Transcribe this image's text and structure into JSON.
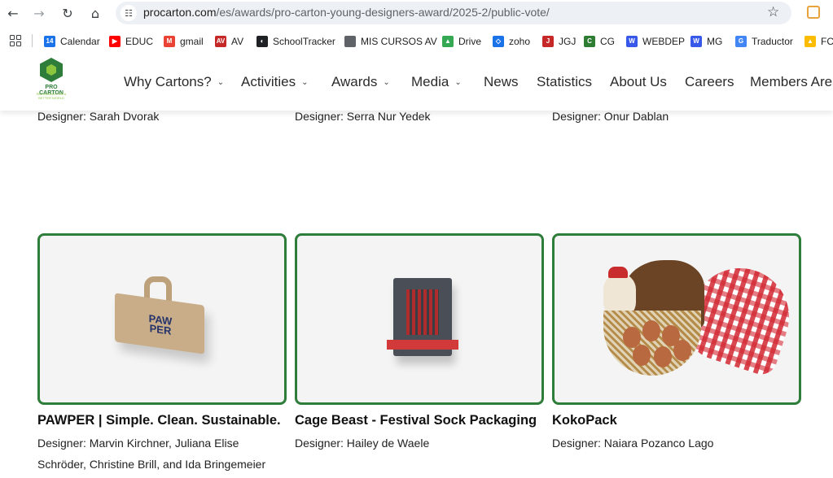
{
  "browser": {
    "url_host": "procarton.com",
    "url_path": "/es/awards/pro-carton-young-designers-award/2025-2/public-vote/",
    "bookmarks": [
      {
        "label": "Calendar",
        "icon": "calendar-icon",
        "color": "#1a73e8",
        "badge": "14"
      },
      {
        "label": "EDUC",
        "icon": "youtube-icon",
        "color": "#ff0000",
        "badge": "▶"
      },
      {
        "label": "gmail",
        "icon": "gmail-icon",
        "color": "#ea4335",
        "badge": "M"
      },
      {
        "label": "AV",
        "icon": "av-icon",
        "color": "#c62828",
        "badge": "AV"
      },
      {
        "label": "SchoolTracker",
        "icon": "schooltracker-icon",
        "color": "#202124",
        "badge": "◐"
      },
      {
        "label": "MIS CURSOS AV",
        "icon": "folder-icon",
        "color": "#5f6368",
        "badge": ""
      },
      {
        "label": "Drive",
        "icon": "drive-icon",
        "color": "#34a853",
        "badge": "▲"
      },
      {
        "label": "zoho",
        "icon": "zoho-icon",
        "color": "#1a73e8",
        "badge": "◇"
      },
      {
        "label": "JGJ",
        "icon": "jgj-icon",
        "color": "#c62828",
        "badge": "J"
      },
      {
        "label": "CG",
        "icon": "cg-icon",
        "color": "#2e7d32",
        "badge": "C"
      },
      {
        "label": "WEBDEP",
        "icon": "wordpress-icon",
        "color": "#3858e9",
        "badge": "W"
      },
      {
        "label": "MG",
        "icon": "wordpress-icon",
        "color": "#3858e9",
        "badge": "W"
      },
      {
        "label": "Traductor",
        "icon": "translate-icon",
        "color": "#4285f4",
        "badge": "G"
      },
      {
        "label": "FC",
        "icon": "drive-icon",
        "color": "#fbbc04",
        "badge": "▲"
      }
    ]
  },
  "site": {
    "logo_name": "PRO CARTON",
    "logo_tagline": "PACKAGING FOR A BETTER WORLD",
    "nav": [
      {
        "label": "Why Cartons?",
        "has_dropdown": true
      },
      {
        "label": "Activities",
        "has_dropdown": true
      },
      {
        "label": "Awards",
        "has_dropdown": true
      },
      {
        "label": "Media",
        "has_dropdown": true
      },
      {
        "label": "News",
        "has_dropdown": false
      },
      {
        "label": "Statistics",
        "has_dropdown": false
      },
      {
        "label": "About Us",
        "has_dropdown": false
      },
      {
        "label": "Careers",
        "has_dropdown": false
      },
      {
        "label": "Members Area",
        "has_dropdown": false
      }
    ]
  },
  "previous_row": [
    {
      "designer": "Designer: Sarah Dvorak"
    },
    {
      "designer": "Designer: Serra Nur Yedek"
    },
    {
      "designer": "Designer: Onur Dablan"
    }
  ],
  "entries": [
    {
      "title": "PAWPER | Simple. Clean. Sustainable.",
      "designer_line1": "Designer: Marvin Kirchner, Juliana Elise",
      "designer_line2": "Schröder, Christine Brill, and Ida Bringemeier",
      "product_text": "PAW PER"
    },
    {
      "title": "Cage Beast - Festival Sock Packaging",
      "designer_line1": "Designer: Hailey de Waele",
      "designer_line2": ""
    },
    {
      "title": "KokoPack",
      "designer_line1": "Designer: Naiara Pozanco Lago",
      "designer_line2": ""
    }
  ],
  "colors": {
    "card_border": "#2e7d3a",
    "brand_green": "#2e7d3a",
    "brand_light_green": "#8cc63f"
  }
}
